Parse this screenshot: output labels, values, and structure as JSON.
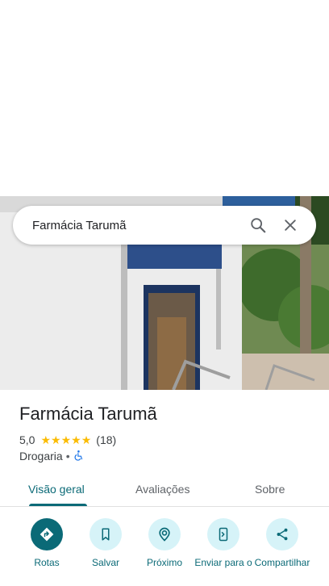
{
  "search": {
    "query": "Farmácia Tarumã"
  },
  "place": {
    "name": "Farmácia Tarumã",
    "rating": "5,0",
    "stars": 5,
    "review_count": "(18)",
    "category": "Drogaria",
    "separator": "•"
  },
  "tabs": [
    {
      "label": "Visão geral",
      "active": true
    },
    {
      "label": "Avaliações",
      "active": false
    },
    {
      "label": "Sobre",
      "active": false
    }
  ],
  "actions": [
    {
      "label": "Rotas",
      "icon": "directions-icon"
    },
    {
      "label": "Salvar",
      "icon": "bookmark-icon"
    },
    {
      "label": "Próximo",
      "icon": "nearby-icon"
    },
    {
      "label": "Enviar para o",
      "icon": "send-to-phone-icon"
    },
    {
      "label": "Compartilhar",
      "icon": "share-icon"
    }
  ],
  "colors": {
    "accent": "#0b6a77",
    "chip": "#d6f3f8",
    "star": "#fbbc04"
  }
}
